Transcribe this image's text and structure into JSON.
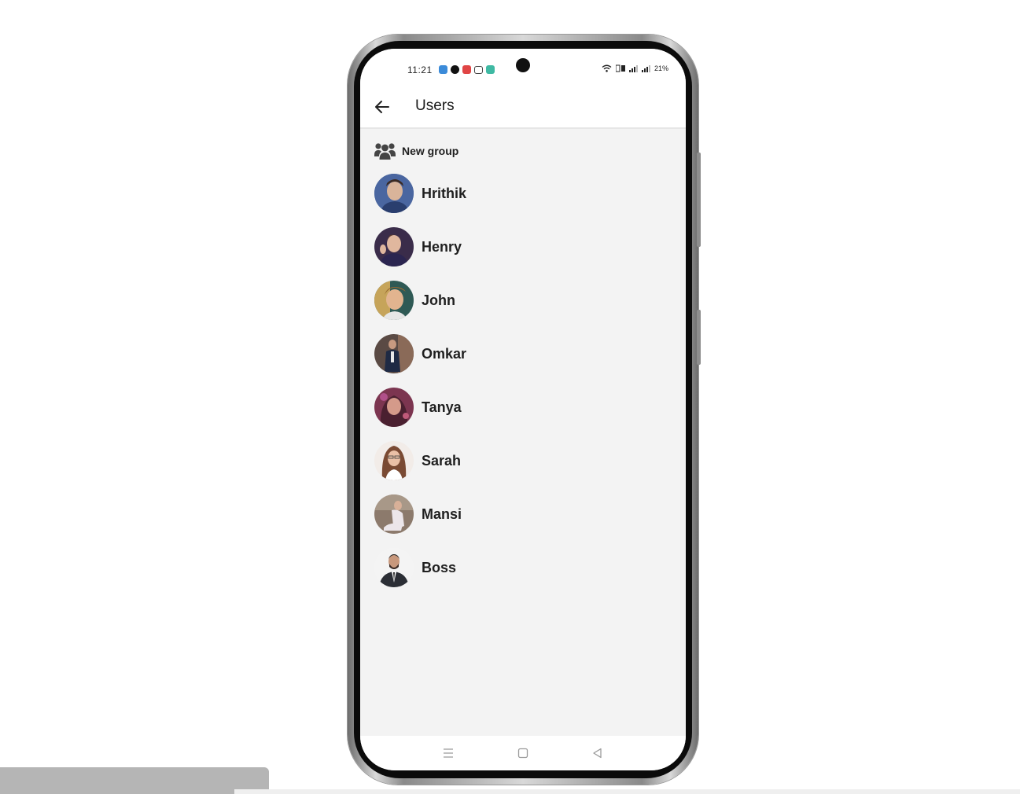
{
  "status_bar": {
    "time": "11:21",
    "battery": "21%",
    "notification_colors": [
      "#3b8bd9",
      "#111111",
      "#e04545",
      "#444444",
      "#3fb9a3"
    ]
  },
  "app_bar": {
    "title": "Users",
    "back_icon": "arrow-left-icon"
  },
  "new_group": {
    "label": "New group",
    "icon": "users-group-icon"
  },
  "users": [
    {
      "name": "Hrithik",
      "avatar_bg": "#3e5a8c",
      "avatar_fg": "#d9b49a"
    },
    {
      "name": "Henry",
      "avatar_bg": "#3a2c4a",
      "avatar_fg": "#e0b79e"
    },
    {
      "name": "John",
      "avatar_bg": "#2f5a55",
      "avatar_fg": "#e2b48f"
    },
    {
      "name": "Omkar",
      "avatar_bg": "#5a4a44",
      "avatar_fg": "#1f2a44"
    },
    {
      "name": "Tanya",
      "avatar_bg": "#7c3550",
      "avatar_fg": "#d49a8a"
    },
    {
      "name": "Sarah",
      "avatar_bg": "#f2ece8",
      "avatar_fg": "#7a4a33"
    },
    {
      "name": "Mansi",
      "avatar_bg": "#8c7a6c",
      "avatar_fg": "#ece6ea"
    },
    {
      "name": "Boss",
      "avatar_bg": "#f4f4f4",
      "avatar_fg": "#2b2e35"
    }
  ],
  "nav_bar": {
    "menu_icon": "menu-lines-icon",
    "home_icon": "square-home-icon",
    "back_icon": "triangle-back-icon"
  }
}
